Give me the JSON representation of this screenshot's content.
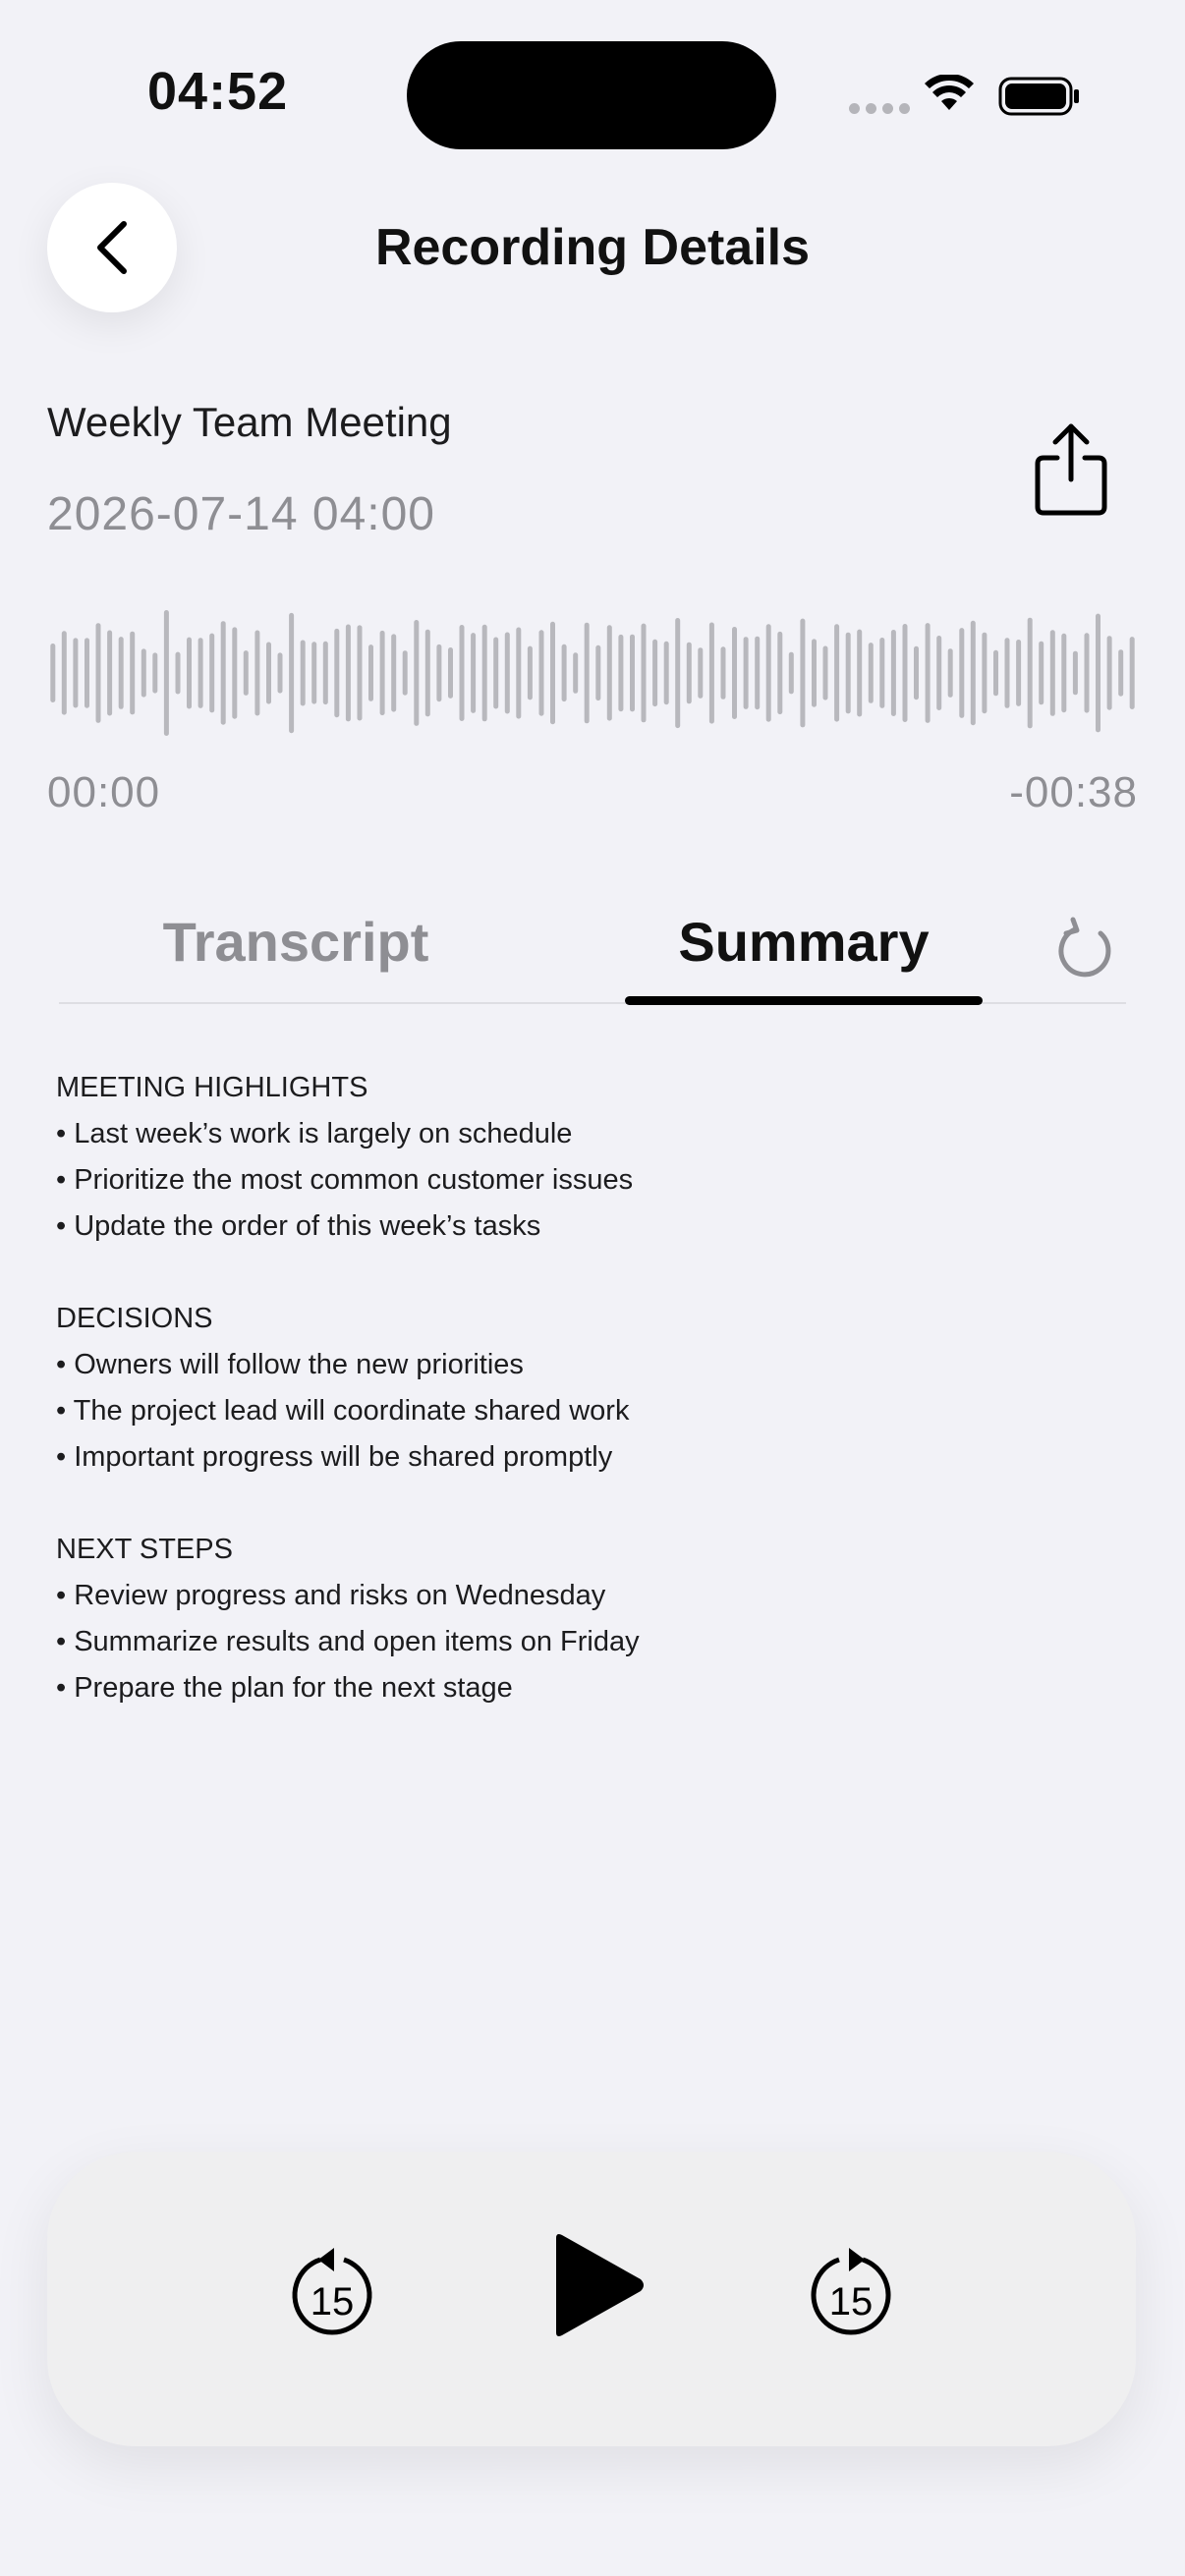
{
  "status_bar": {
    "time": "04:52"
  },
  "nav": {
    "title": "Recording Details",
    "back_icon": "chevron-left-icon"
  },
  "recording": {
    "title": "Weekly Team Meeting",
    "date": "2026-07-14 04:00",
    "share_icon": "share-icon",
    "elapsed": "00:00",
    "remaining": "-00:38",
    "progress": 0
  },
  "tabs": {
    "items": [
      {
        "label": "Transcript",
        "active": false
      },
      {
        "label": "Summary",
        "active": true
      }
    ],
    "refresh_icon": "refresh-icon"
  },
  "summary": {
    "sections": [
      {
        "heading": "MEETING HIGHLIGHTS",
        "items": [
          "• Last week’s work is largely on schedule",
          "• Prioritize the most common customer issues",
          "• Update the order of this week’s tasks"
        ]
      },
      {
        "heading": "DECISIONS",
        "items": [
          "• Owners will follow the new priorities",
          "• The project lead will coordinate shared work",
          "• Important progress will be shared promptly"
        ]
      },
      {
        "heading": "NEXT STEPS",
        "items": [
          "• Review progress and risks on Wednesday",
          "• Summarize results and open items on Friday",
          "• Prepare the plan for the next stage"
        ]
      }
    ]
  },
  "player": {
    "skip_back_label": "15",
    "skip_forward_label": "15",
    "play_icon": "play-icon"
  },
  "colors": {
    "background": "#f2f2f7",
    "waveform": "#b8b8bd",
    "secondary_text": "#8e8e93",
    "accent": "#000000"
  }
}
